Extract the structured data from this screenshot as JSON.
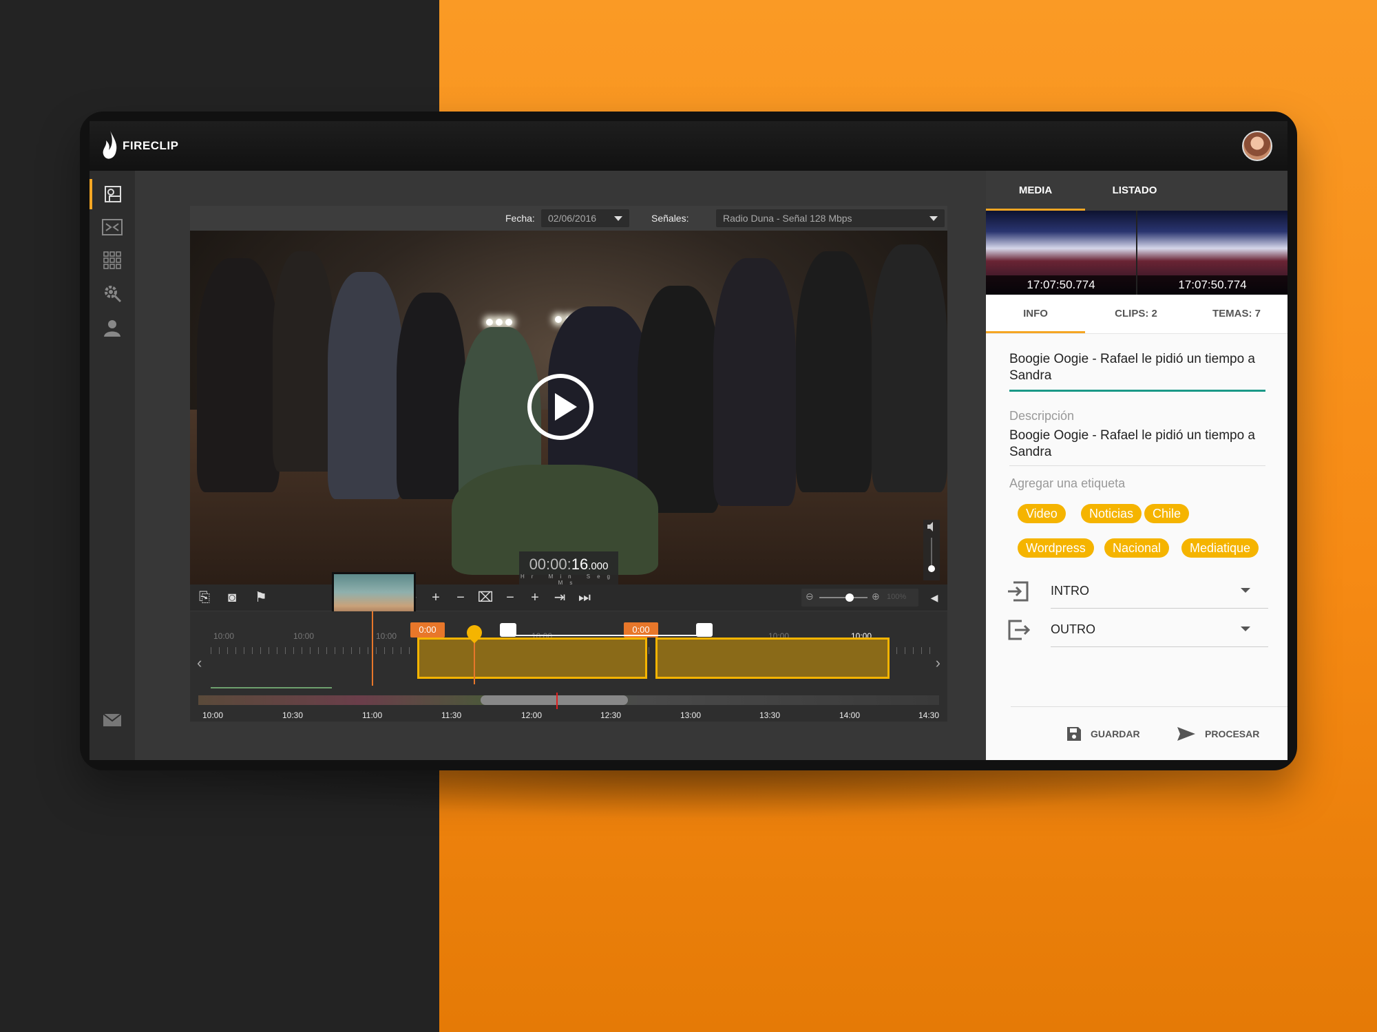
{
  "app": {
    "name": "FIRECLIP"
  },
  "player": {
    "fecha_label": "Fecha:",
    "fecha_value": "02/06/2016",
    "senales_label": "Señales:",
    "senales_value": "Radio Duna - Señal 128 Mbps",
    "timecode": {
      "dim": "00:00:",
      "seconds": "16",
      "ms": ".000",
      "units": "Hr Min Seg Ms"
    }
  },
  "timeline": {
    "badge_1": "0:00",
    "badge_2": "0:00",
    "upper_labels": [
      "10:00",
      "10:00",
      "10:00",
      "10:00",
      "10:00",
      "10:00"
    ],
    "axis_labels": [
      "10:00",
      "10:30",
      "11:00",
      "11:30",
      "12:00",
      "12:30",
      "13:00",
      "13:30",
      "14:00",
      "14:30"
    ],
    "zoom_level": "100%"
  },
  "right_panel": {
    "tabs": [
      "MEDIA",
      "LISTADO"
    ],
    "frame_times": [
      "17:07:50.774",
      "17:07:50.774"
    ],
    "info_tabs": [
      "INFO",
      "CLIPS: 2",
      "TEMAS: 7"
    ],
    "title": "Boogie Oogie - Rafael le pidió un tiempo a Sandra",
    "description_label": "Descripción",
    "description": "Boogie Oogie - Rafael le pidió un tiempo a Sandra",
    "tag_placeholder": "Agregar una etiqueta",
    "tags_row1": [
      "Video",
      "Noticias",
      "Chile"
    ],
    "tags_row2": [
      "Wordpress",
      "Nacional",
      "Mediatique"
    ],
    "intro_label": "INTRO",
    "outro_label": "OUTRO",
    "save_label": "GUARDAR",
    "process_label": "PROCESAR"
  },
  "colors": {
    "accent": "#f5a623",
    "clip": "#f5b400",
    "teal": "#1a9987",
    "orange_bg": "#f68a14"
  }
}
